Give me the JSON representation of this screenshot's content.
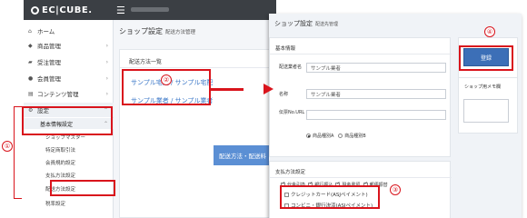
{
  "left": {
    "logo": "EC|CUBE.",
    "sidebar": [
      {
        "label": "ホーム",
        "icon": "home-icon"
      },
      {
        "label": "商品管理",
        "icon": "tag-icon"
      },
      {
        "label": "受注管理",
        "icon": "cart-icon"
      },
      {
        "label": "会員管理",
        "icon": "user-icon"
      },
      {
        "label": "コンテンツ管理",
        "icon": "content-icon"
      },
      {
        "label": "設定",
        "icon": "gear-icon"
      }
    ],
    "sub_header": "基本情報設定",
    "sub_items": [
      "ショップマスター",
      "特定商取引法",
      "会員規約設定",
      "支払方法設定",
      "配送方法設定",
      "税率設定"
    ],
    "page_title": "ショップ設定",
    "page_subtitle": "配送方法管理",
    "card_title": "配送方法一覧",
    "links": [
      "サンプル宅配 / サンプル宅配",
      "サンプル業者 / サンプル業者"
    ],
    "button": "配送方法・配送料"
  },
  "right": {
    "title": "ショップ設定",
    "subtitle": "配送先管理",
    "section1": "基本情報",
    "fields": [
      {
        "label": "配送業者名",
        "value": "サンプル業者"
      },
      {
        "label": "名称",
        "value": "サンプル業者"
      },
      {
        "label": "伝票No.URL",
        "value": ""
      }
    ],
    "radios": [
      "商品種別A",
      "商品種別B"
    ],
    "section2": "支払方法設定",
    "payments": [
      "代金引換",
      "銀行振込",
      "現金書留",
      "郵便振替"
    ],
    "payments2": [
      "クレジットカード(ASJペイメント)",
      "コンビニ・銀行決済(ASJペイメント)"
    ],
    "register": "登録",
    "memo_title": "ショップ用メモ欄"
  },
  "markers": [
    "①",
    "②",
    "③",
    "④"
  ]
}
